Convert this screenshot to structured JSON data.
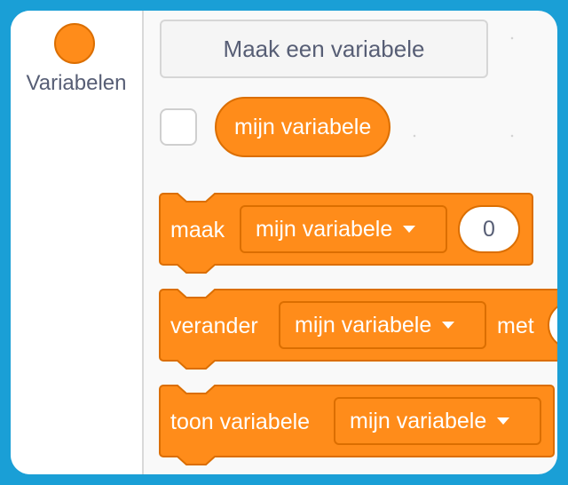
{
  "sidebar": {
    "category": {
      "label": "Variabelen",
      "color": "#ff8c1a"
    }
  },
  "palette": {
    "make_variable_button": "Maak een variabele",
    "variable_reporter": "mijn variabele",
    "blocks": {
      "set": {
        "label": "maak",
        "dropdown": "mijn variabele",
        "value": "0"
      },
      "change": {
        "label": "verander",
        "dropdown": "mijn variabele",
        "suffix": "met"
      },
      "show": {
        "label": "toon variabele",
        "dropdown": "mijn variabele"
      }
    }
  },
  "colors": {
    "block": "#ff8c1a",
    "block_border": "#db6e00",
    "text": "#575e75",
    "frame": "#1a9fd6"
  }
}
